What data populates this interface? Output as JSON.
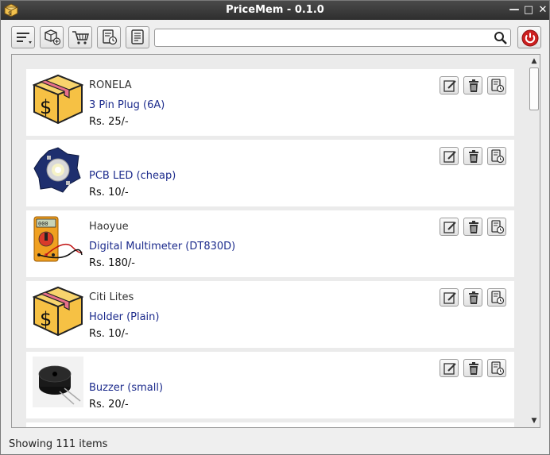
{
  "window": {
    "title": "PriceMem - 0.1.0",
    "controls": {
      "minimize": "—",
      "maximize": "□",
      "close": "✕"
    }
  },
  "toolbar": {
    "buttons": [
      {
        "icon": "menu-icon"
      },
      {
        "icon": "add-item-icon"
      },
      {
        "icon": "cart-icon"
      },
      {
        "icon": "history-icon"
      },
      {
        "icon": "receipt-icon"
      }
    ],
    "search": {
      "value": "",
      "placeholder": ""
    },
    "power_icon": "power-icon"
  },
  "items": [
    {
      "brand": "RONELA",
      "name": "3 Pin Plug (6A)",
      "price": "Rs. 25/-",
      "image": "box-dollar-icon"
    },
    {
      "brand": "",
      "name": "PCB LED (cheap)",
      "price": "Rs. 10/-",
      "image": "led-photo"
    },
    {
      "brand": "Haoyue",
      "name": "Digital Multimeter (DT830D)",
      "price": "Rs. 180/-",
      "image": "multimeter-photo"
    },
    {
      "brand": "Citi Lites",
      "name": "Holder (Plain)",
      "price": "Rs. 10/-",
      "image": "box-dollar-icon"
    },
    {
      "brand": "",
      "name": "Buzzer (small)",
      "price": "Rs. 20/-",
      "image": "buzzer-photo"
    }
  ],
  "status": {
    "text": "Showing 111 items"
  },
  "colors": {
    "title_bar": "#3a3a3a",
    "link": "#1c2b8c",
    "power": "#cc1f1f"
  }
}
